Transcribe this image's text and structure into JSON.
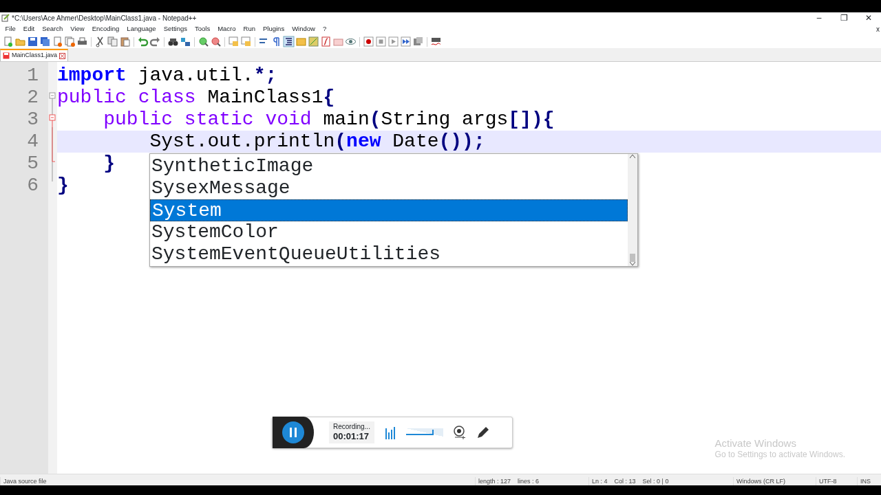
{
  "window": {
    "title": "*C:\\Users\\Ace Ahmer\\Desktop\\MainClass1.java - Notepad++",
    "controls": [
      "–",
      "❐",
      "✕"
    ],
    "close_doc": "x"
  },
  "menu": [
    "File",
    "Edit",
    "Search",
    "View",
    "Encoding",
    "Language",
    "Settings",
    "Tools",
    "Macro",
    "Run",
    "Plugins",
    "Window",
    "?"
  ],
  "tabs": [
    {
      "label": "MainClass1.java",
      "selected": true,
      "modified": true
    }
  ],
  "editor": {
    "lines": [
      {
        "number": "1",
        "current": false,
        "tokens": [
          {
            "kind": "keyword",
            "text": "import"
          },
          {
            "kind": "plain",
            "text": " java.util."
          },
          {
            "kind": "op",
            "text": "*;"
          }
        ]
      },
      {
        "number": "2",
        "current": false,
        "tokens": [
          {
            "kind": "type",
            "text": "public"
          },
          {
            "kind": "type",
            "text": " class"
          },
          {
            "kind": "plain",
            "text": " MainClass1"
          },
          {
            "kind": "op",
            "text": "{"
          }
        ]
      },
      {
        "number": "3",
        "current": false,
        "tokens": [
          {
            "kind": "type",
            "text": "    public"
          },
          {
            "kind": "type",
            "text": " static"
          },
          {
            "kind": "type",
            "text": " void"
          },
          {
            "kind": "plain",
            "text": " main"
          },
          {
            "kind": "op",
            "text": "("
          },
          {
            "kind": "plain",
            "text": "String args"
          },
          {
            "kind": "op",
            "text": "[]){"
          }
        ]
      },
      {
        "number": "4",
        "current": true,
        "tokens": [
          {
            "kind": "plain",
            "text": "        Syst.out.println"
          },
          {
            "kind": "op",
            "text": "("
          },
          {
            "kind": "keyword",
            "text": "new"
          },
          {
            "kind": "plain",
            "text": " Date"
          },
          {
            "kind": "op",
            "text": "());"
          }
        ]
      },
      {
        "number": "5",
        "current": false,
        "tokens": [
          {
            "kind": "op",
            "text": "    }"
          }
        ]
      },
      {
        "number": "6",
        "current": false,
        "tokens": [
          {
            "kind": "op",
            "text": "}"
          }
        ]
      }
    ],
    "autocomplete": [
      {
        "label": "SyntheticImage",
        "selected": false
      },
      {
        "label": "SysexMessage",
        "selected": false
      },
      {
        "label": "System",
        "selected": true
      },
      {
        "label": "SystemColor",
        "selected": false
      },
      {
        "label": "SystemEventQueueUtilities",
        "selected": false
      }
    ]
  },
  "recorder": {
    "status": "Recording...",
    "time": "00:01:17",
    "volume": {
      "level": 0.75
    }
  },
  "activation": {
    "title": "Activate Windows",
    "text": "Go to Settings to activate Windows."
  },
  "status_bar": [
    "Java source file",
    "length : 127    lines : 6",
    "Ln : 4    Col : 13    Sel : 0 | 0",
    "Windows (CR LF)",
    "UTF-8",
    "INS"
  ]
}
